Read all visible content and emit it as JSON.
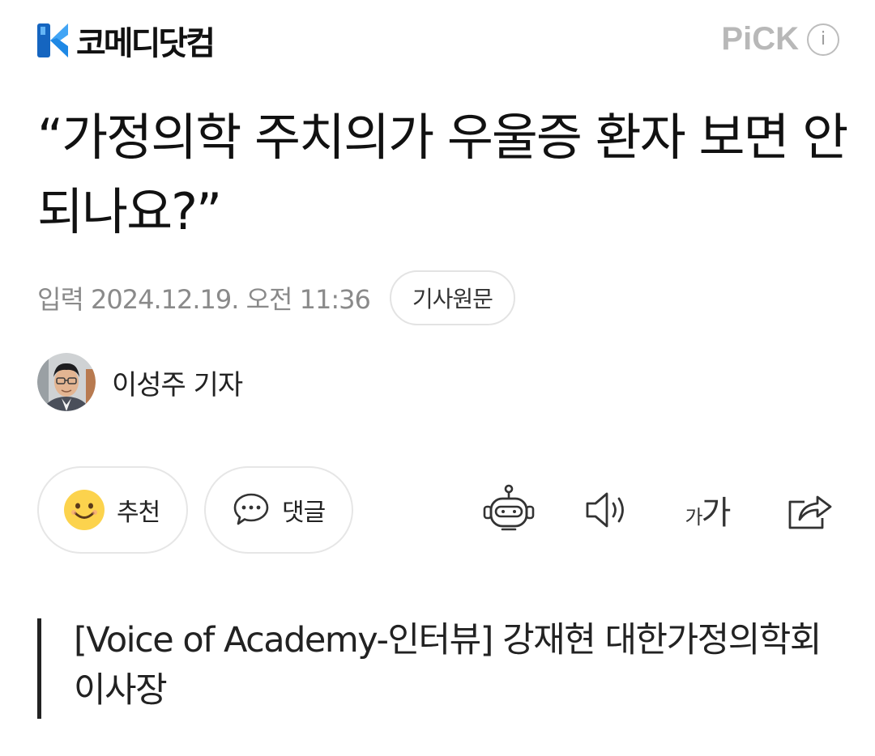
{
  "header": {
    "logo_text": "코메디닷컴",
    "logo_icon": "komedi-logo-icon",
    "pick_label": "PiCK",
    "info_icon_glyph": "i"
  },
  "article": {
    "headline": "“가정의학 주치의가 우울증 환자 보면 안되나요?”",
    "date_label": "입력 2024.12.19. 오전 11:36",
    "original_button": "기사원문",
    "author_name": "이성주 기자",
    "subheadline": "[Voice of Academy-인터뷰] 강재현 대한가정의학회 이사장"
  },
  "actions": {
    "like_label": "추천",
    "comment_label": "댓글",
    "font_small": "가",
    "font_large": "가",
    "icons": [
      "smile-icon",
      "speech-bubble-icon",
      "robot-icon",
      "speaker-icon",
      "font-size-icon",
      "share-icon"
    ]
  },
  "colors": {
    "logo_blue": "#1e88e5",
    "logo_light_blue": "#52b6f5",
    "smile_yellow": "#fcd34d",
    "muted_gray": "#8a8a8a",
    "pick_gray": "#b8b8b8"
  }
}
